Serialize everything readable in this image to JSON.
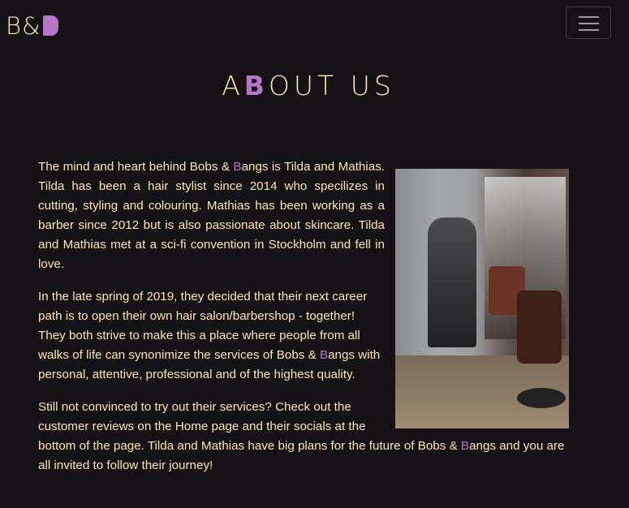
{
  "navbar": {
    "brand_prefix": "B&",
    "toggle_label": "Toggle navigation"
  },
  "about": {
    "title_first": "A",
    "title_accent": "B",
    "title_rest": "OUT US",
    "photo_alt": "Salon interior with barber chairs"
  },
  "paragraphs": [
    {
      "before": "The mind and heart behind Bobs & ",
      "accent": "B",
      "after": "angs is Tilda and Mathias. Tilda has been a hair stylist since 2014 who specilizes in cutting, styling and colouring. Mathias has been working as a barber since 2012 but is also passionate about skincare. Tilda and Mathias met at a sci-fi convention in Stockholm and fell in love."
    },
    {
      "before": "In the late spring of 2019, they decided that their next career path is to open their own hair salon/barbershop - together! They both strive to make this a place where people from all walks of life can synonimize the services of Bobs & ",
      "accent": "B",
      "after": "angs with personal, attentive, professional and of the highest quality."
    },
    {
      "before": "Still not convinced to try out their services? Check out the customer reviews on the Home page and their socials at the bottom of the page. Tilda and Mathias have big plans for the future of Bobs & ",
      "accent": "B",
      "after": "angs and you are all invited to follow their journey!"
    }
  ],
  "colors": {
    "background": "#141215",
    "text": "#fbe6b4",
    "accent": "#b576c9"
  },
  "icons": {
    "toggle": "hamburger-menu-icon"
  }
}
